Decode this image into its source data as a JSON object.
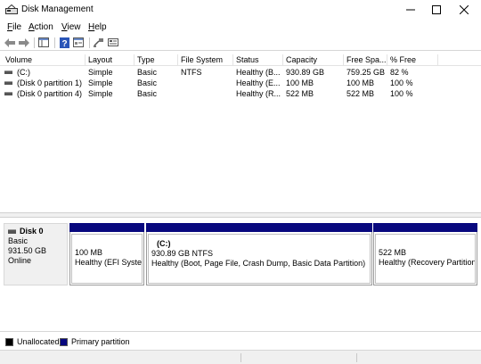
{
  "window": {
    "title": "Disk Management"
  },
  "menu": {
    "file": {
      "accel": "F",
      "rest": "ile"
    },
    "action": {
      "accel": "A",
      "rest": "ction"
    },
    "view": {
      "accel": "V",
      "rest": "iew"
    },
    "help": {
      "accel": "H",
      "rest": "elp"
    }
  },
  "toolbar": {
    "icons": [
      "back-arrow-icon",
      "forward-arrow-icon",
      "show-hide-tree-icon",
      "help-icon",
      "properties-icon",
      "connect-icon",
      "settings-icon"
    ]
  },
  "volume_list": {
    "columns": [
      "Volume",
      "Layout",
      "Type",
      "File System",
      "Status",
      "Capacity",
      "Free Spa...",
      "% Free"
    ],
    "rows": [
      {
        "volume": "(C:)",
        "layout": "Simple",
        "type": "Basic",
        "file_system": "NTFS",
        "status": "Healthy (B...",
        "capacity": "930.89 GB",
        "free_space": "759.25 GB",
        "percent_free": "82 %"
      },
      {
        "volume": "(Disk 0 partition 1)",
        "layout": "Simple",
        "type": "Basic",
        "file_system": "",
        "status": "Healthy (E...",
        "capacity": "100 MB",
        "free_space": "100 MB",
        "percent_free": "100 %"
      },
      {
        "volume": "(Disk 0 partition 4)",
        "layout": "Simple",
        "type": "Basic",
        "file_system": "",
        "status": "Healthy (R...",
        "capacity": "522 MB",
        "free_space": "522 MB",
        "percent_free": "100 %"
      }
    ]
  },
  "disk": {
    "name": "Disk 0",
    "type": "Basic",
    "size": "931.50 GB",
    "state": "Online",
    "partitions": [
      {
        "title": "",
        "size": "100 MB",
        "status": "Healthy (EFI System Partition)"
      },
      {
        "title": "(C:)",
        "size": "930.89 GB NTFS",
        "status": "Healthy (Boot, Page File, Crash Dump, Basic Data Partition)"
      },
      {
        "title": "",
        "size": "522 MB",
        "status": "Healthy (Recovery Partition)"
      }
    ]
  },
  "legend": {
    "unallocated": "Unallocated",
    "primary": "Primary partition",
    "unallocated_color": "#000000",
    "primary_color": "#08087e"
  }
}
